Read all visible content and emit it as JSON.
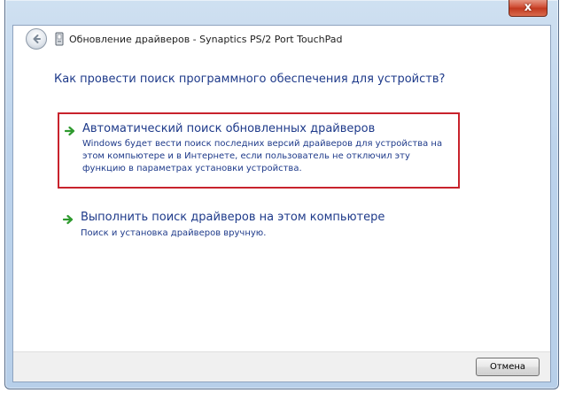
{
  "window": {
    "title": "Обновление драйверов - Synaptics PS/2 Port TouchPad",
    "close_label": "x"
  },
  "icons": {
    "back": "back-arrow-icon",
    "device": "device-icon",
    "option_arrow": "green-arrow-icon"
  },
  "main": {
    "heading": "Как провести поиск программного обеспечения для устройств?",
    "options": [
      {
        "title": "Автоматический поиск обновленных драйверов",
        "description": "Windows будет вести поиск последних версий драйверов для устройства на этом компьютере и в Интернете, если пользователь не отключил эту функцию в параметрах установки устройства.",
        "highlighted": true
      },
      {
        "title": "Выполнить поиск драйверов на этом компьютере",
        "description": "Поиск и установка драйверов вручную.",
        "highlighted": false
      }
    ]
  },
  "footer": {
    "cancel_label": "Отмена"
  },
  "colors": {
    "link_blue": "#1e3a8a",
    "highlight_red": "#c8232c",
    "arrow_green": "#2e9a2e",
    "close_red": "#c23a20"
  }
}
